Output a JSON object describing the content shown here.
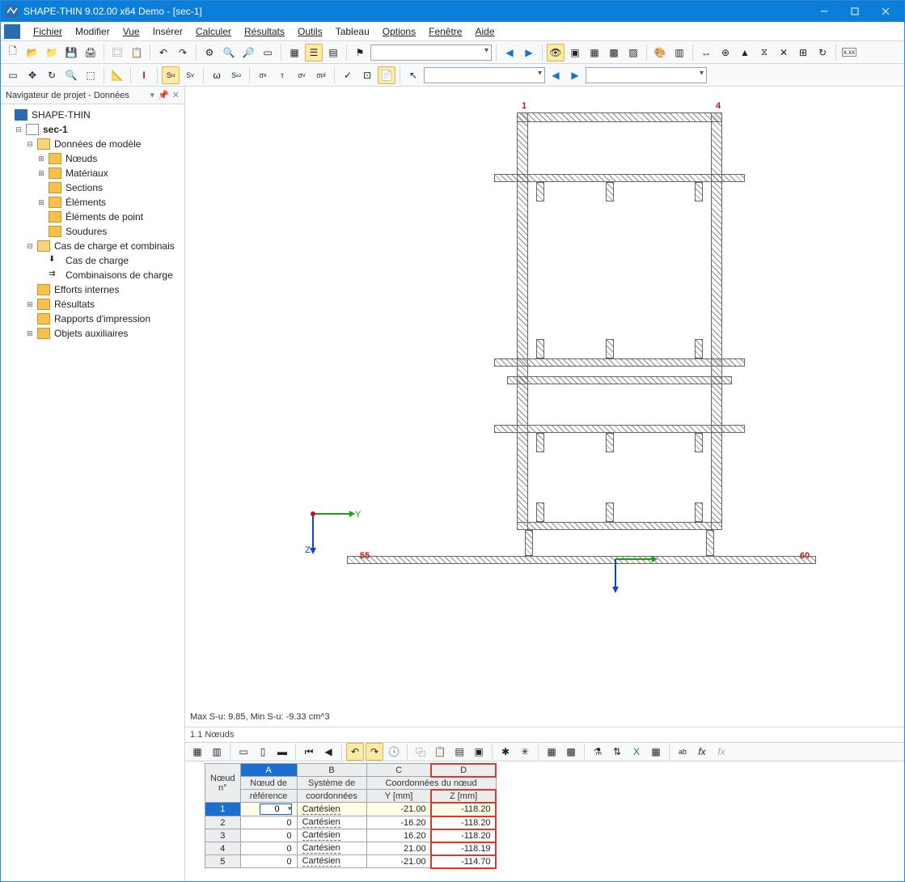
{
  "title": "SHAPE-THIN 9.02.00 x64 Demo - [sec-1]",
  "menu": {
    "file": "Fichier",
    "edit": "Modifier",
    "view": "Vue",
    "insert": "Insérer",
    "calc": "Calculer",
    "results": "Résultats",
    "tools": "Outils",
    "table": "Tableau",
    "options": "Options",
    "window": "Fenêtre",
    "help": "Aide"
  },
  "nav": {
    "title": "Navigateur de projet - Données",
    "root": "SHAPE-THIN",
    "project": "sec-1",
    "modeldata": "Données de modèle",
    "nodes": "Nœuds",
    "materials": "Matériaux",
    "sections": "Sections",
    "elements": "Éléments",
    "pointelements": "Éléments de point",
    "welds": "Soudures",
    "loadcases_group": "Cas de charge et combinais",
    "loadcases": "Cas de charge",
    "loadcombos": "Combinaisons de charge",
    "internal": "Efforts internes",
    "results": "Résultats",
    "printouts": "Rapports d'impression",
    "aux": "Objets auxiliaires"
  },
  "viewport": {
    "status": "Max S-u: 9.85, Min S-u: -9.33 cm^3",
    "axis_y": "Y",
    "axis_z": "Z",
    "labels": {
      "n1": "1",
      "n4": "4",
      "n55": "55",
      "n60": "60"
    }
  },
  "table": {
    "title": "1.1 Nœuds",
    "col_letters": [
      "A",
      "B",
      "C",
      "D"
    ],
    "group_header": "Coordonnées du nœud",
    "headers": {
      "rownum": "Nœud n°",
      "A1": "Nœud de",
      "A2": "référence",
      "B1": "Système de",
      "B2": "coordonnées",
      "C": "Y [mm]",
      "D": "Z [mm]"
    },
    "edit_value": "0",
    "rows": [
      {
        "n": "1",
        "ref": "0",
        "sys": "Cartésien",
        "y": "-21.00",
        "z": "-118.20"
      },
      {
        "n": "2",
        "ref": "0",
        "sys": "Cartésien",
        "y": "-16.20",
        "z": "-118.20"
      },
      {
        "n": "3",
        "ref": "0",
        "sys": "Cartésien",
        "y": "16.20",
        "z": "-118.20"
      },
      {
        "n": "4",
        "ref": "0",
        "sys": "Cartésien",
        "y": "21.00",
        "z": "-118.19"
      },
      {
        "n": "5",
        "ref": "0",
        "sys": "Cartésien",
        "y": "-21.00",
        "z": "-114.70"
      }
    ]
  }
}
